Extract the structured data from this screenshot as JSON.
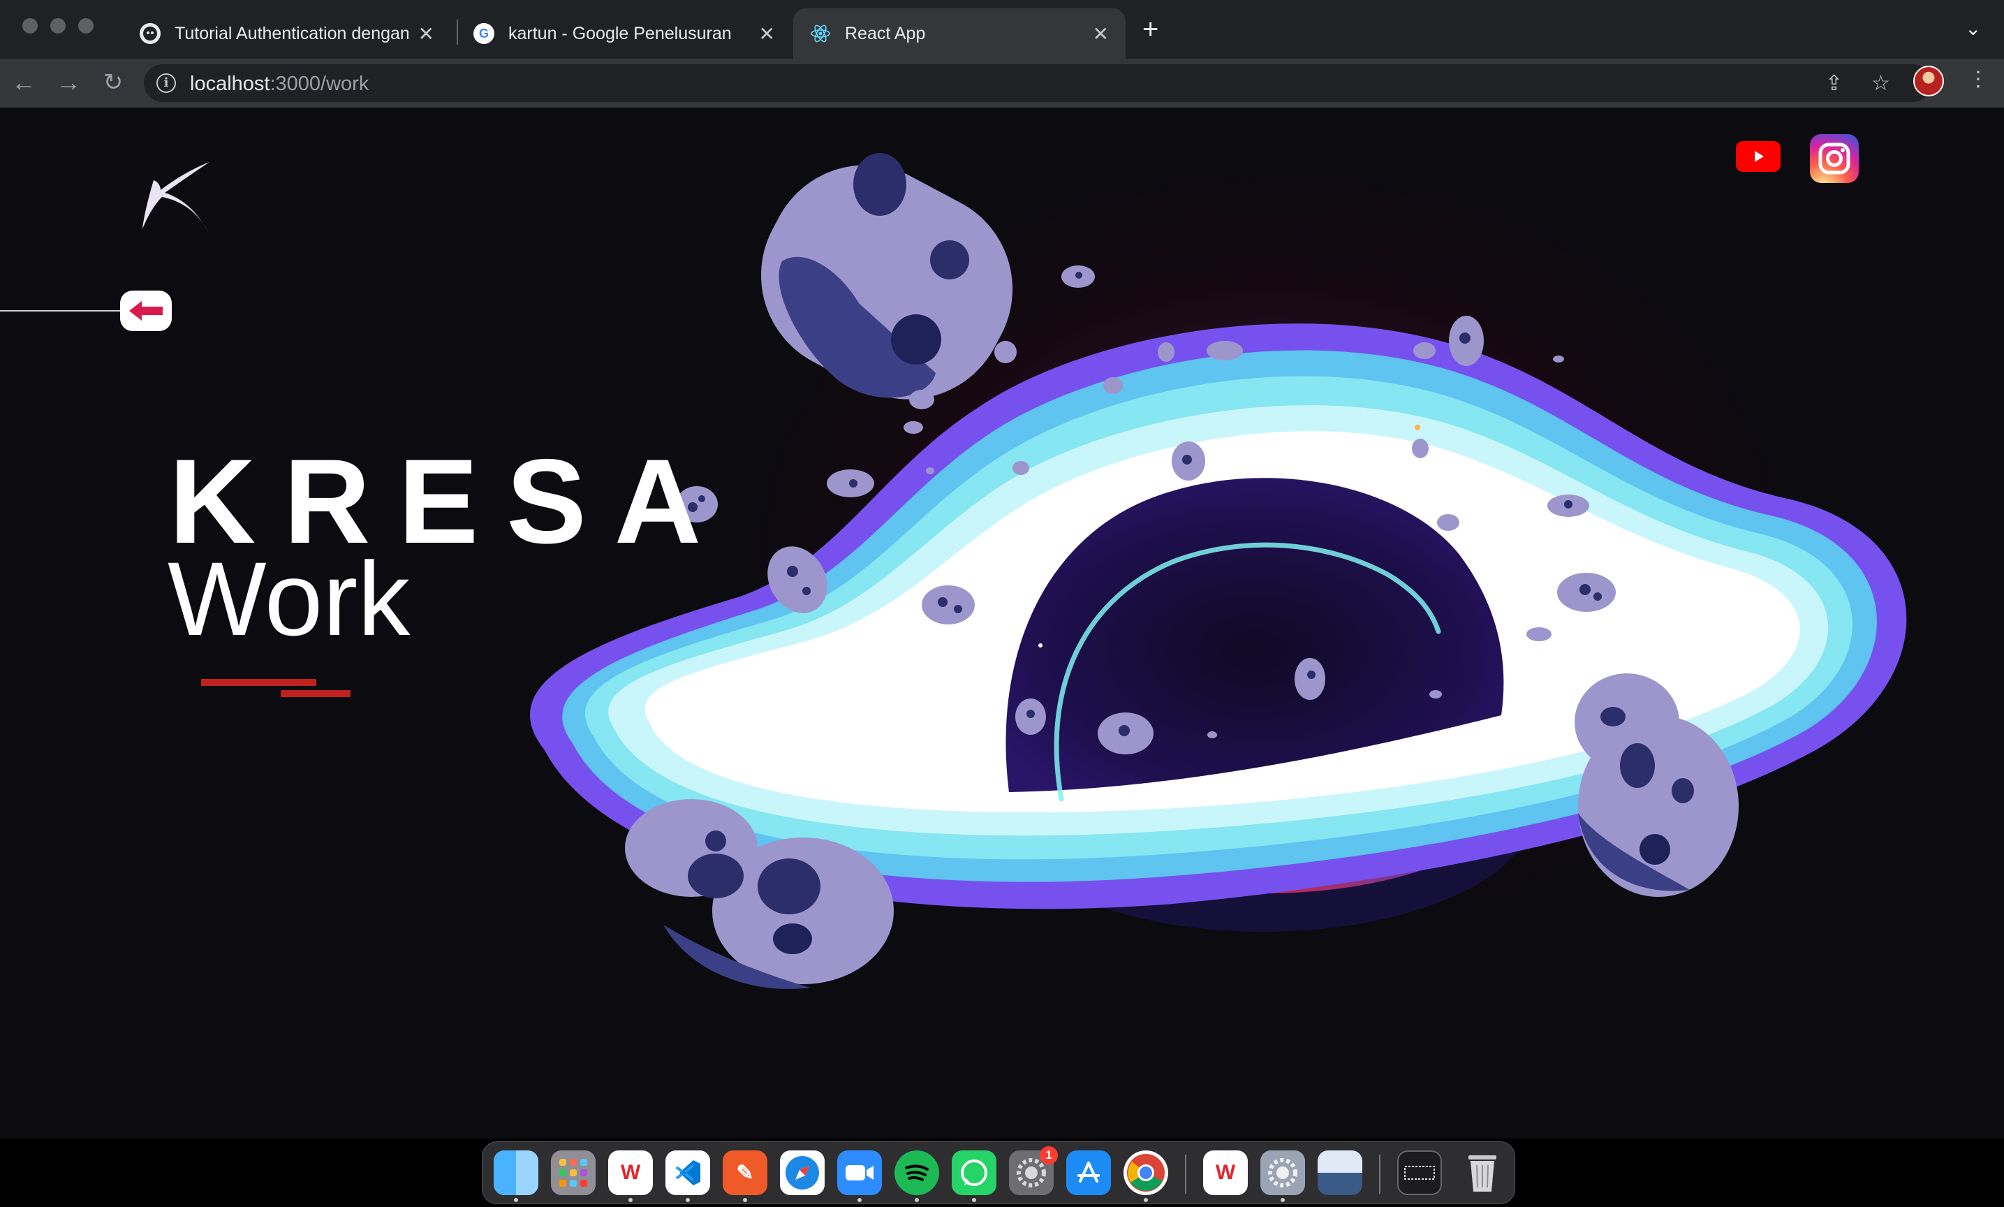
{
  "browser": {
    "tabs": [
      {
        "title": "Tutorial Authentication dengan",
        "icon": "github-icon"
      },
      {
        "title": "kartun - Google Penelusuran",
        "icon": "google-icon"
      },
      {
        "title": "React App",
        "icon": "react-icon"
      }
    ],
    "address": {
      "host": "localhost",
      "path": ":3000/work"
    }
  },
  "page": {
    "title_top": "KRESA",
    "title_bottom": "Work",
    "social": [
      "youtube-icon",
      "instagram-icon"
    ],
    "colors": {
      "accent_red": "#c0211f",
      "back_arrow": "#d81b4a",
      "background": "#0b0b10"
    }
  },
  "dock": {
    "apps": [
      "finder",
      "launchpad",
      "wps-office",
      "vscode",
      "pen-app",
      "safari",
      "zoom",
      "spotify",
      "whatsapp",
      "system-preferences",
      "app-store",
      "chrome",
      "wps-office-2",
      "system-preferences-2",
      "preview",
      "screenshot",
      "trash"
    ],
    "badge": "1"
  }
}
